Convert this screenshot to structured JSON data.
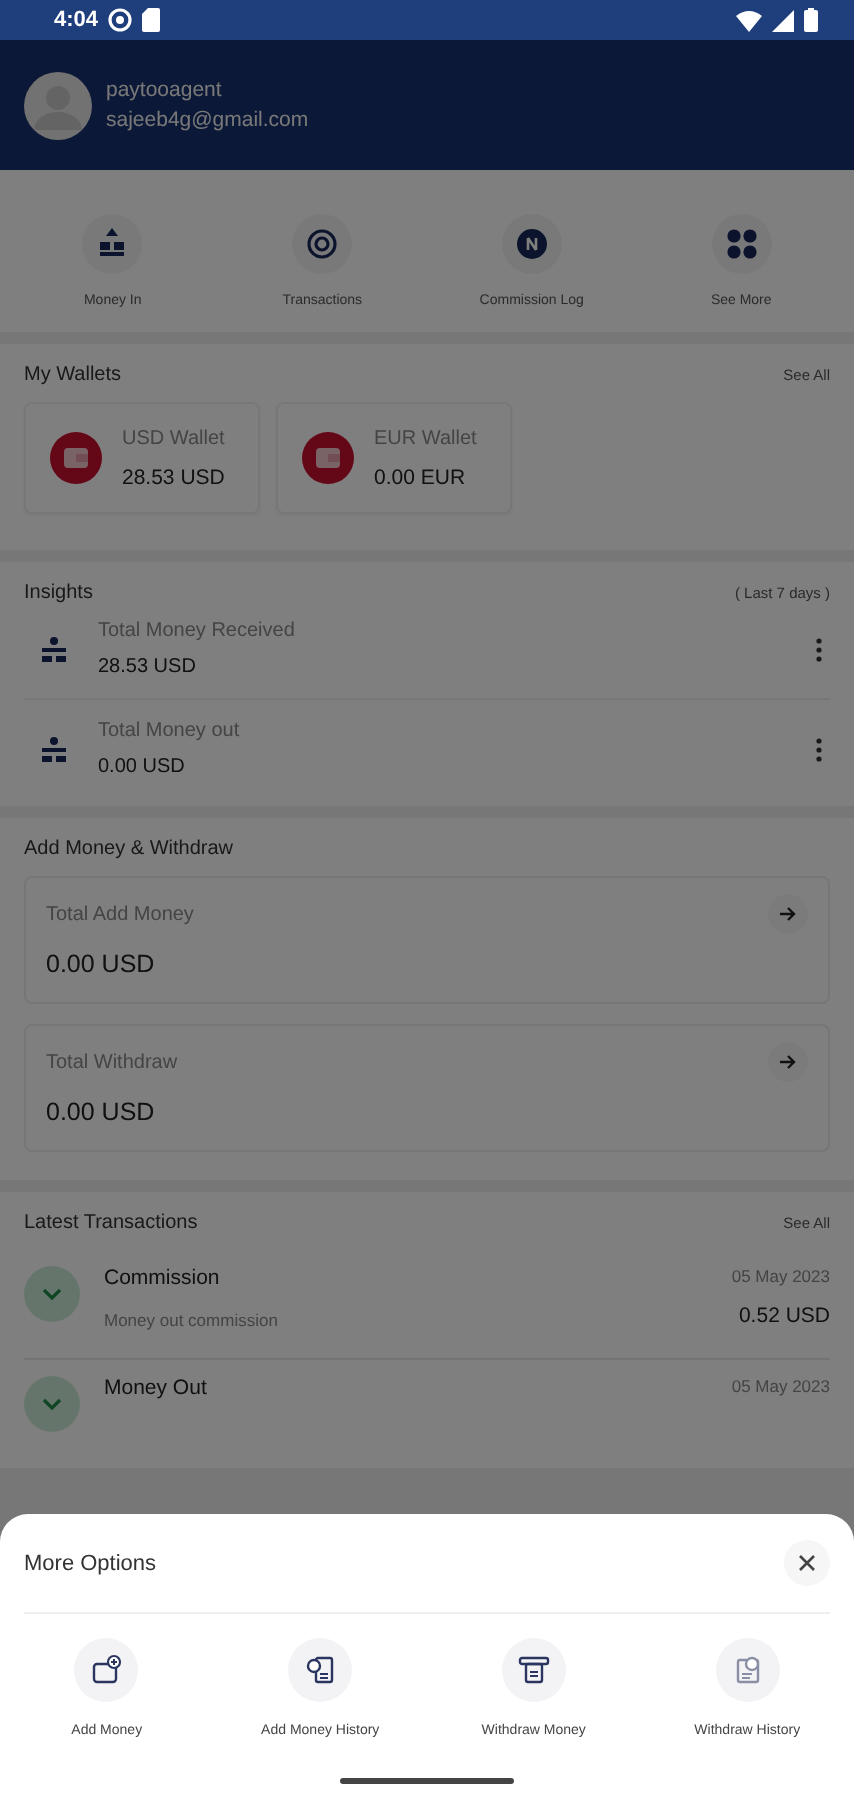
{
  "status_bar": {
    "time": "4:04"
  },
  "profile": {
    "name": "paytooagent",
    "email": "sajeeb4g@gmail.com"
  },
  "quick_actions": [
    {
      "label": "Money In",
      "kind": "money-in"
    },
    {
      "label": "Transactions",
      "kind": "transactions"
    },
    {
      "label": "Commission Log",
      "kind": "commission"
    },
    {
      "label": "See More",
      "kind": "grid"
    }
  ],
  "wallets": {
    "title": "My Wallets",
    "see_all": "See All",
    "items": [
      {
        "name": "USD Wallet",
        "balance": "28.53 USD"
      },
      {
        "name": "EUR Wallet",
        "balance": "0.00 EUR"
      }
    ]
  },
  "insights": {
    "title": "Insights",
    "period": "( Last 7 days )",
    "items": [
      {
        "label": "Total Money Received",
        "amount": "28.53 USD"
      },
      {
        "label": "Total Money out",
        "amount": "0.00 USD"
      }
    ]
  },
  "add_withdraw": {
    "title": "Add Money & Withdraw",
    "items": [
      {
        "label": "Total Add Money",
        "amount": "0.00 USD"
      },
      {
        "label": "Total Withdraw",
        "amount": "0.00 USD"
      }
    ]
  },
  "transactions": {
    "title": "Latest Transactions",
    "see_all": "See All",
    "items": [
      {
        "title": "Commission",
        "subtitle": "Money out commission",
        "date": "05 May 2023",
        "amount": "0.52 USD"
      },
      {
        "title": "Money Out",
        "date": "05 May 2023"
      }
    ]
  },
  "sheet": {
    "title": "More Options",
    "options": [
      {
        "label": "Add Money",
        "kind": "add-money"
      },
      {
        "label": "Add Money History",
        "kind": "add-history"
      },
      {
        "label": "Withdraw Money",
        "kind": "withdraw"
      },
      {
        "label": "Withdraw History",
        "kind": "withdraw-history"
      }
    ]
  }
}
